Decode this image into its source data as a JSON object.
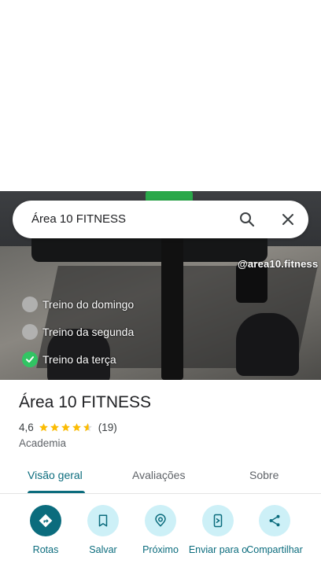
{
  "search": {
    "query": "Área 10 FITNESS"
  },
  "photo": {
    "watermark": "@area10.fitness",
    "checklist": [
      {
        "label": "Treino do domingo",
        "done": false
      },
      {
        "label": "Treino da segunda",
        "done": false
      },
      {
        "label": "Treino da terça",
        "done": true
      }
    ]
  },
  "place": {
    "title": "Área 10 FITNESS",
    "rating": "4,6",
    "rating_value": 4.6,
    "review_count": "(19)",
    "category": "Academia"
  },
  "tabs": [
    {
      "label": "Visão geral",
      "active": true
    },
    {
      "label": "Avaliações",
      "active": false
    },
    {
      "label": "Sobre",
      "active": false
    }
  ],
  "actions": [
    {
      "label": "Rotas",
      "icon": "directions-icon"
    },
    {
      "label": "Salvar",
      "icon": "bookmark-icon"
    },
    {
      "label": "Próximo",
      "icon": "nearby-icon"
    },
    {
      "label": "Enviar para o",
      "icon": "send-to-phone-icon"
    },
    {
      "label": "Compartilhar",
      "icon": "share-icon"
    }
  ],
  "colors": {
    "accent": "#0b6c7d",
    "action_bg": "#cdf0f7",
    "star": "#fbbc04",
    "check": "#31c463"
  }
}
